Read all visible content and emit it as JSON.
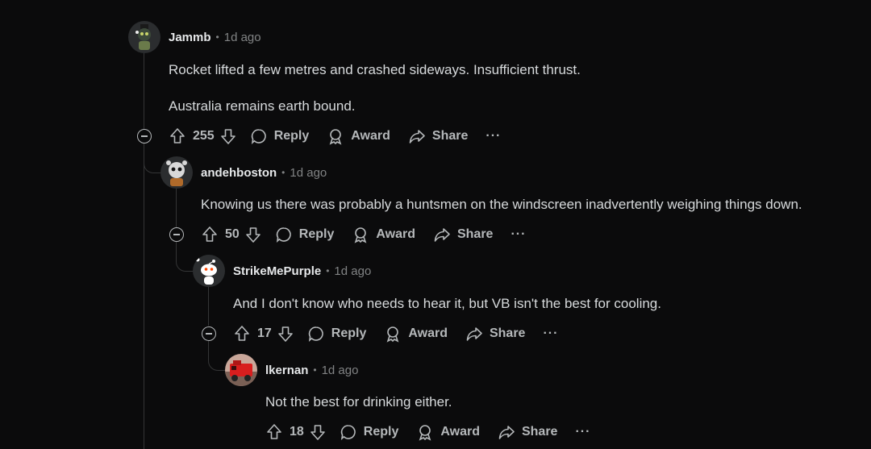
{
  "comments": [
    {
      "username": "Jammb",
      "dot": "•",
      "time": "1d ago",
      "body": [
        "Rocket lifted a few metres and crashed sideways. Insufficient thrust.",
        "Australia remains earth bound."
      ],
      "votes": "255",
      "reply": "Reply",
      "award": "Award",
      "share": "Share",
      "more": "···"
    },
    {
      "username": "andehboston",
      "dot": "•",
      "time": "1d ago",
      "body": [
        "Knowing us there was probably a huntsmen on the windscreen inadvertently weighing things down."
      ],
      "votes": "50",
      "reply": "Reply",
      "award": "Award",
      "share": "Share",
      "more": "···"
    },
    {
      "username": "StrikeMePurple",
      "dot": "•",
      "time": "1d ago",
      "body": [
        "And I don't know who needs to hear it, but VB isn't the best for cooling."
      ],
      "votes": "17",
      "reply": "Reply",
      "award": "Award",
      "share": "Share",
      "more": "···"
    },
    {
      "username": "lkernan",
      "dot": "•",
      "time": "1d ago",
      "body": [
        "Not the best for drinking either."
      ],
      "votes": "18",
      "reply": "Reply",
      "award": "Award",
      "share": "Share",
      "more": "···"
    }
  ],
  "colors": {
    "background": "#0b0b0c",
    "text": "#d7dadc",
    "muted": "#818384",
    "thread_line": "#343536"
  },
  "icons": [
    "upvote-icon",
    "downvote-icon",
    "comment-icon",
    "award-icon",
    "share-icon",
    "collapse-icon",
    "more-icon"
  ]
}
